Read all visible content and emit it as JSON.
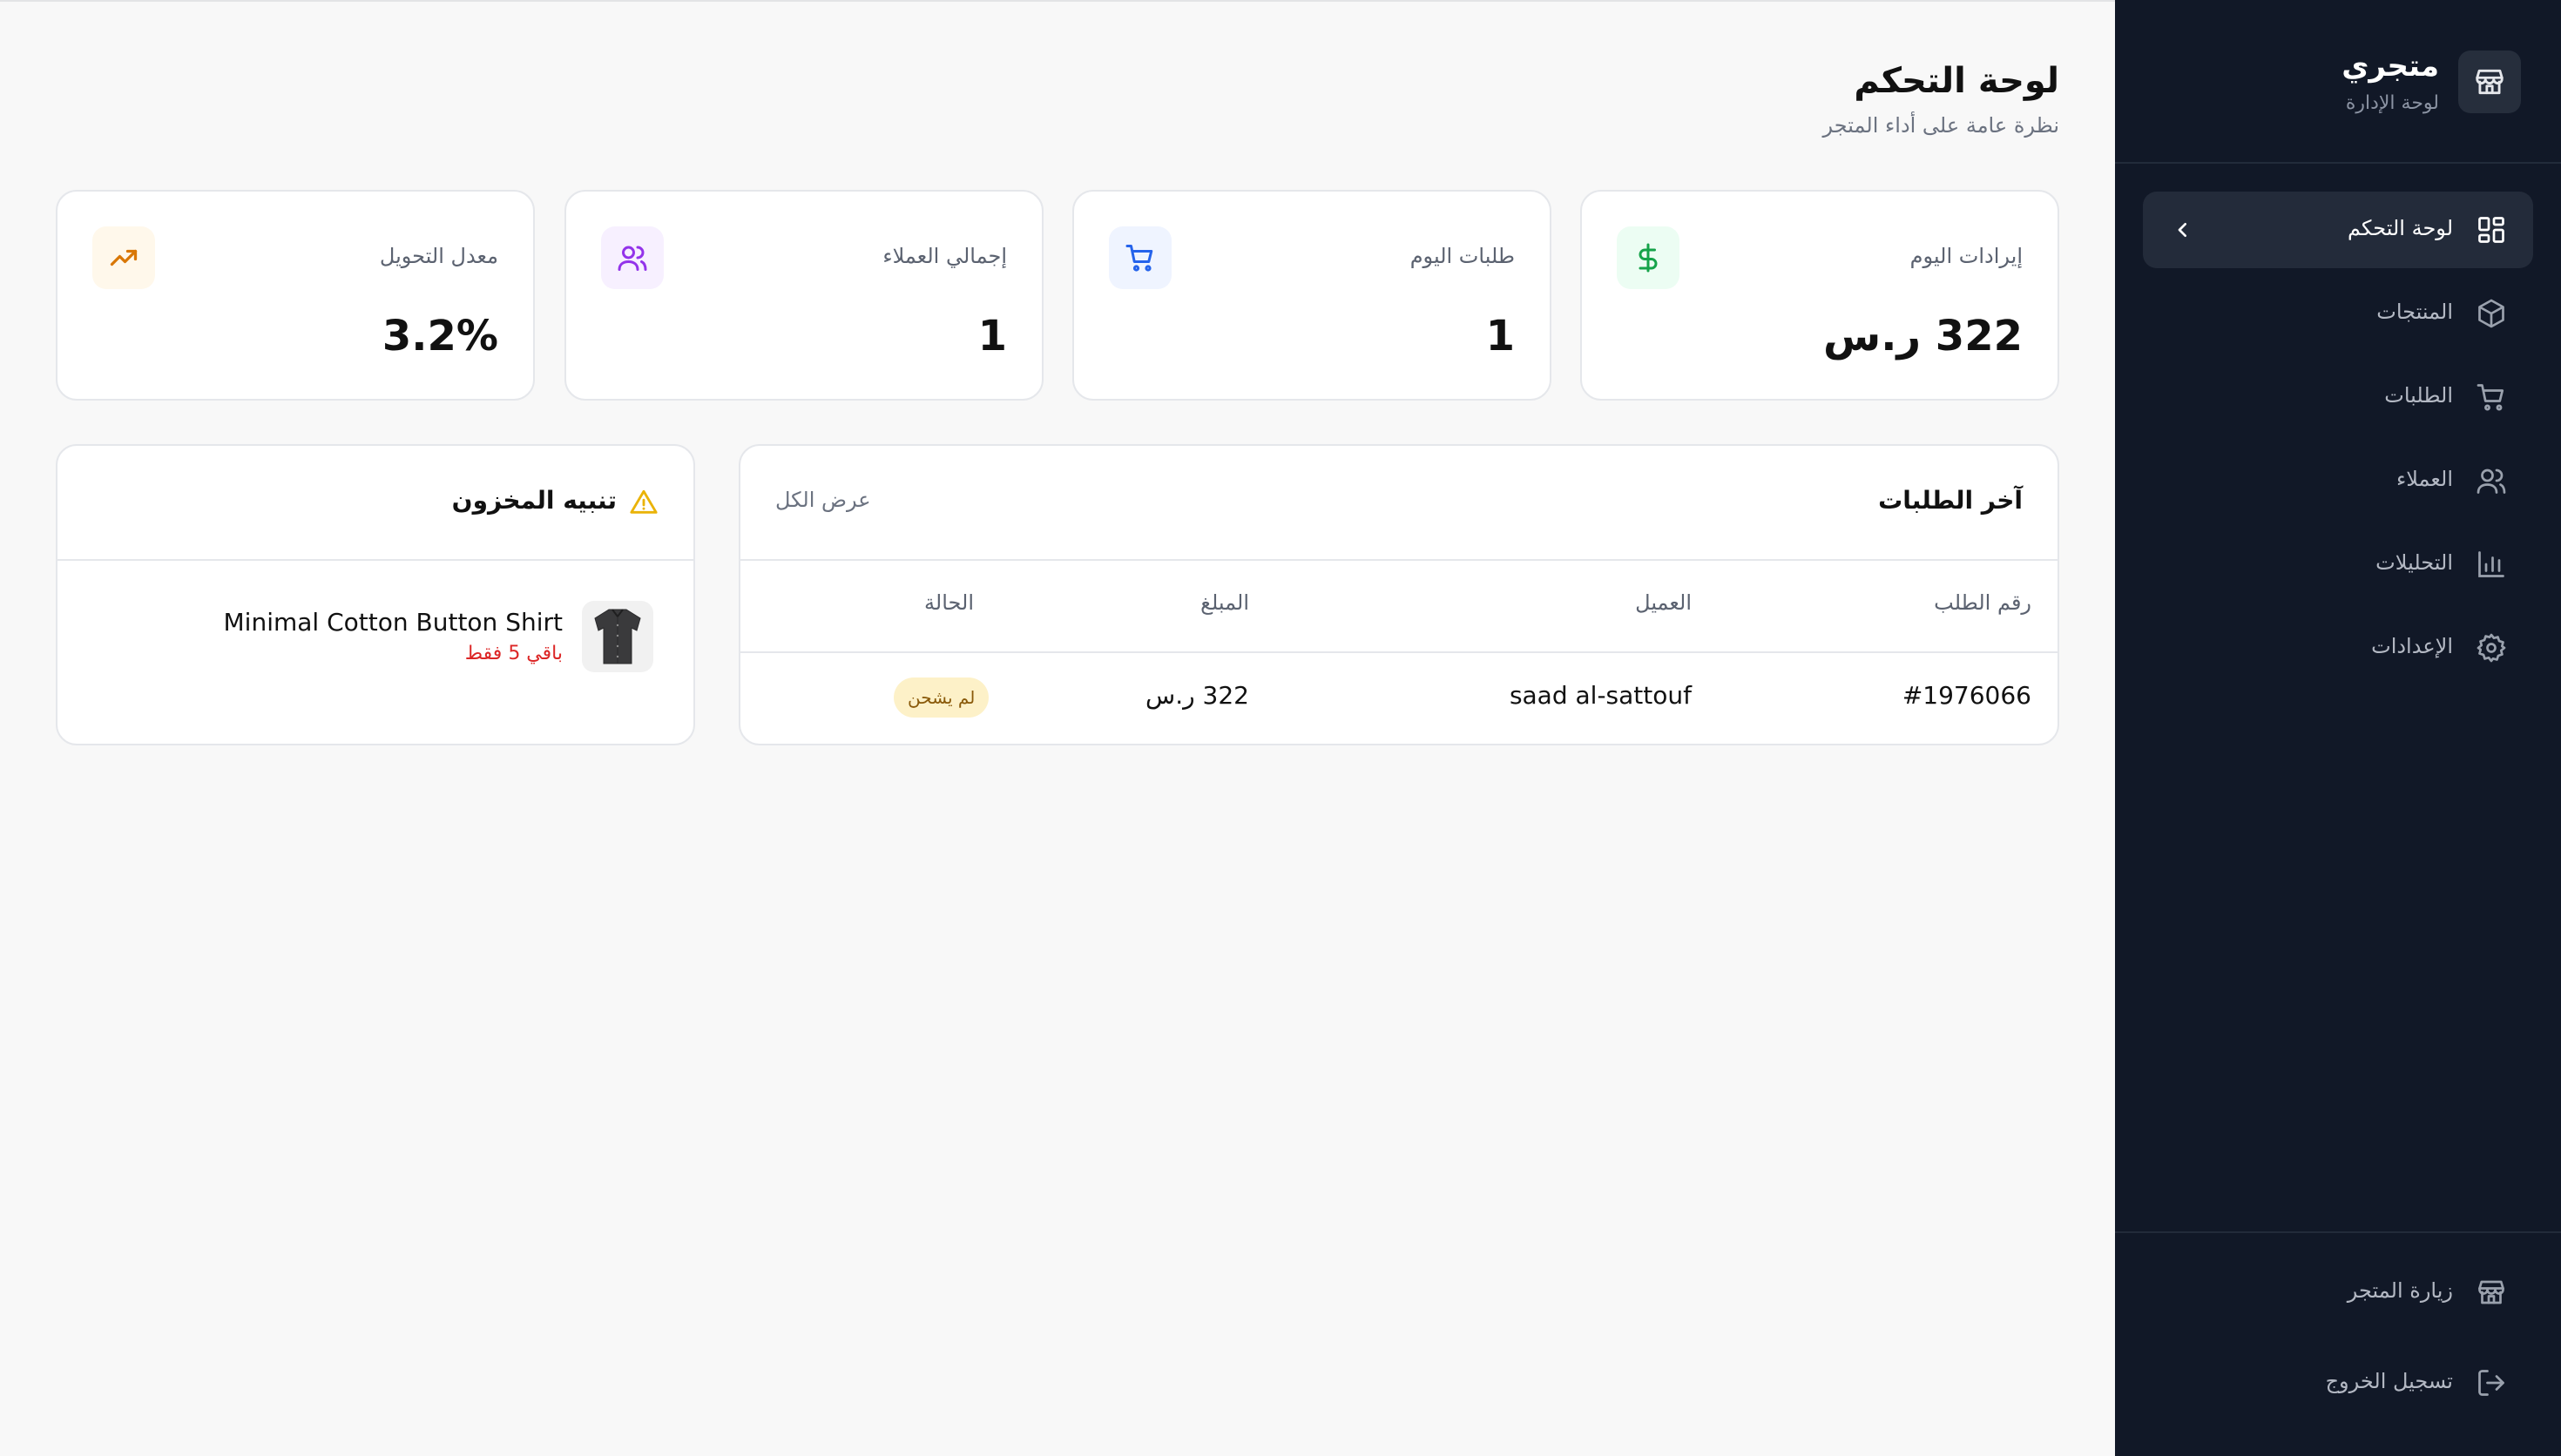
{
  "sidebar": {
    "brand_title": "متجري",
    "brand_subtitle": "لوحة الإدارة",
    "items": [
      {
        "label": "لوحة التحكم",
        "icon": "dashboard-grid-icon",
        "active": true
      },
      {
        "label": "المنتجات",
        "icon": "package-icon"
      },
      {
        "label": "الطلبات",
        "icon": "cart-icon"
      },
      {
        "label": "العملاء",
        "icon": "users-icon"
      },
      {
        "label": "التحليلات",
        "icon": "bar-chart-icon"
      },
      {
        "label": "الإعدادات",
        "icon": "gear-icon"
      }
    ],
    "bottom": [
      {
        "label": "زيارة المتجر",
        "icon": "store-icon"
      },
      {
        "label": "تسجيل الخروج",
        "icon": "logout-icon"
      }
    ]
  },
  "header": {
    "title": "لوحة التحكم",
    "subtitle": "نظرة عامة على أداء المتجر"
  },
  "stats": [
    {
      "label": "إيرادات اليوم",
      "value": "322 ر.س",
      "icon": "dollar-icon",
      "color": "#16a34a"
    },
    {
      "label": "طلبات اليوم",
      "value": "1",
      "icon": "cart-icon",
      "color": "#2563eb"
    },
    {
      "label": "إجمالي العملاء",
      "value": "1",
      "icon": "users-icon",
      "color": "#9333ea"
    },
    {
      "label": "معدل التحويل",
      "value": "3.2%",
      "icon": "trending-up-icon",
      "color": "#d97706"
    }
  ],
  "recent_orders": {
    "title": "آخر الطلبات",
    "view_all": "عرض الكل",
    "columns": [
      "رقم الطلب",
      "العميل",
      "المبلغ",
      "الحالة"
    ],
    "rows": [
      {
        "order_id": "#1976066",
        "customer": "saad al-sattouf",
        "amount": "322 ر.س",
        "status": "لم يشحن"
      }
    ]
  },
  "stock_alert": {
    "title": "تنبيه المخزون",
    "items": [
      {
        "name": "Minimal Cotton Button Shirt",
        "note": "باقي 5 فقط"
      }
    ]
  }
}
